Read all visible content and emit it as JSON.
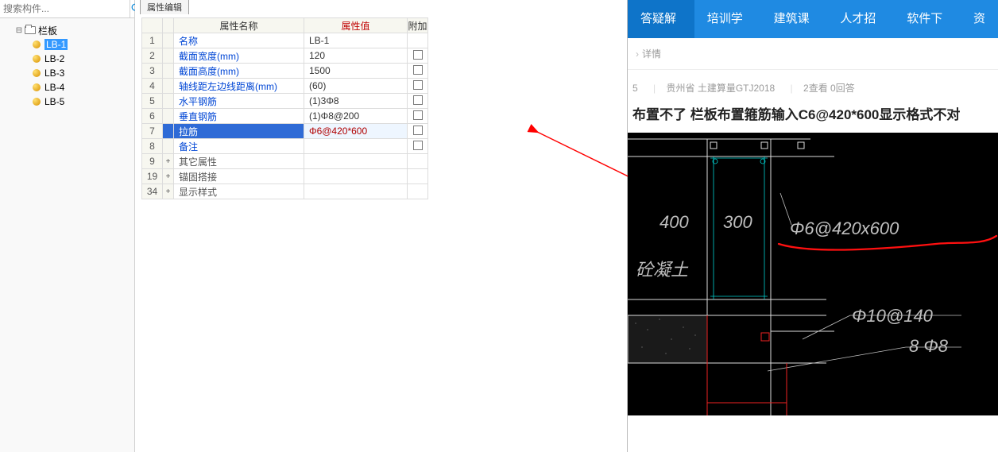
{
  "search": {
    "placeholder": "搜索构件..."
  },
  "tree": {
    "root": "栏板",
    "items": [
      "LB-1",
      "LB-2",
      "LB-3",
      "LB-4",
      "LB-5"
    ],
    "selected": "LB-1"
  },
  "tab": {
    "label": "属性编辑"
  },
  "grid": {
    "cols": {
      "name": "属性名称",
      "value": "属性值",
      "extra": "附加"
    },
    "rows": [
      {
        "n": "1",
        "name": "名称",
        "val": "LB-1",
        "chk": false,
        "link": true
      },
      {
        "n": "2",
        "name": "截面宽度(mm)",
        "val": "120",
        "chk": true,
        "link": true
      },
      {
        "n": "3",
        "name": "截面高度(mm)",
        "val": "1500",
        "chk": true,
        "link": true
      },
      {
        "n": "4",
        "name": "轴线距左边线距离(mm)",
        "val": "(60)",
        "chk": true,
        "link": true
      },
      {
        "n": "5",
        "name": "水平钢筋",
        "val": "(1)3Φ8",
        "chk": true,
        "link": true
      },
      {
        "n": "6",
        "name": "垂直钢筋",
        "val": "(1)Φ8@200",
        "chk": true,
        "link": true
      },
      {
        "n": "7",
        "name": "拉筋",
        "val": "Φ6@420*600",
        "chk": true,
        "link": true,
        "sel": true
      },
      {
        "n": "8",
        "name": "备注",
        "val": "",
        "chk": true,
        "link": true
      },
      {
        "n": "9",
        "name": "其它属性",
        "val": "",
        "chk": false,
        "link": false,
        "exp": "+"
      },
      {
        "n": "19",
        "name": "锚固搭接",
        "val": "",
        "chk": false,
        "link": false,
        "exp": "+"
      },
      {
        "n": "34",
        "name": "显示样式",
        "val": "",
        "chk": false,
        "link": false,
        "exp": "+"
      }
    ]
  },
  "nav": {
    "items": [
      "答疑解惑",
      "培训学习",
      "建筑课堂",
      "人才招聘",
      "软件下载",
      "资"
    ],
    "activeIndex": 0
  },
  "crumb": {
    "tail": "详情"
  },
  "meta": {
    "a": "5",
    "b": "贵州省  土建算量GTJ2018",
    "c": "2查看  0回答"
  },
  "post": {
    "title": "布置不了 栏板布置箍筋输入C6@420*600显示格式不对"
  },
  "cad": {
    "dim400": "400",
    "dim300": "300",
    "label1": "Φ6@420x600",
    "concrete": "砼凝土",
    "label2": "Φ10@140",
    "label3": "8 Φ8"
  }
}
